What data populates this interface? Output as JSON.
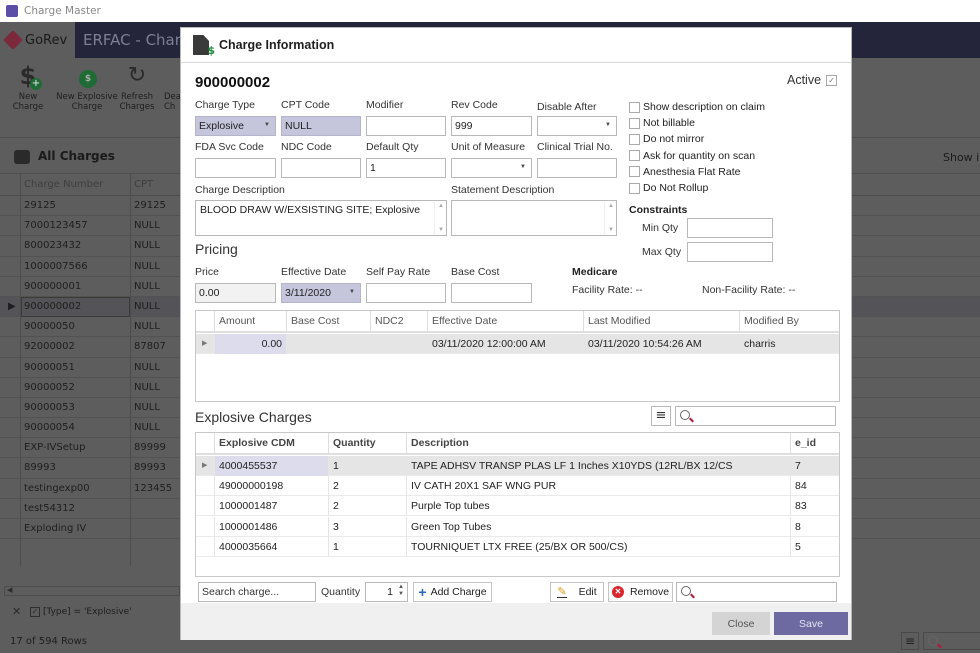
{
  "window": {
    "title": "Charge Master"
  },
  "app": {
    "brand": "GoRev",
    "title": "ERFAC - Char",
    "toolbar": [
      {
        "label_line1": "New Charge",
        "label_line2": "",
        "icon": "dollar-plus-icon"
      },
      {
        "label_line1": "New Explosive",
        "label_line2": "Charge",
        "icon": "bomb-icon"
      },
      {
        "label_line1": "Refresh",
        "label_line2": "Charges",
        "icon": "refresh-icon"
      },
      {
        "label_line1": "Dea",
        "label_line2": "Ch",
        "icon": "deactivate-icon"
      }
    ],
    "list": {
      "title": "All Charges",
      "show_text": "Show i",
      "columns": [
        "Charge Number",
        "CPT"
      ],
      "rows": [
        [
          "29125",
          "29125"
        ],
        [
          "7000123457",
          "NULL"
        ],
        [
          "800023432",
          "NULL"
        ],
        [
          "1000007566",
          "NULL"
        ],
        [
          "900000001",
          "NULL"
        ],
        [
          "900000002",
          "NULL"
        ],
        [
          "90000050",
          "NULL"
        ],
        [
          "92000002",
          "87807"
        ],
        [
          "90000051",
          "NULL"
        ],
        [
          "90000052",
          "NULL"
        ],
        [
          "90000053",
          "NULL"
        ],
        [
          "90000054",
          "NULL"
        ],
        [
          "EXP-IVSetup",
          "89999"
        ],
        [
          "89993",
          "89993"
        ],
        [
          "testingexp00",
          "123455"
        ],
        [
          "test54312",
          ""
        ],
        [
          "Exploding IV",
          ""
        ]
      ],
      "selected_index": 5,
      "filter": {
        "expression": "[Type] = 'Explosive'",
        "enabled": true
      },
      "row_count": "17 of 594 Rows"
    }
  },
  "dialog": {
    "title": "Charge Information",
    "charge_number": "900000002",
    "active": {
      "label": "Active",
      "checked": true
    },
    "fields": {
      "charge_type": {
        "label": "Charge Type",
        "value": "Explosive"
      },
      "cpt_code": {
        "label": "CPT Code",
        "value": "NULL"
      },
      "modifier": {
        "label": "Modifier",
        "value": ""
      },
      "rev_code": {
        "label": "Rev Code",
        "value": "999"
      },
      "disable_after": {
        "label": "Disable After",
        "value": ""
      },
      "fda_svc_code": {
        "label": "FDA Svc Code",
        "value": ""
      },
      "ndc_code": {
        "label": "NDC Code",
        "value": ""
      },
      "default_qty": {
        "label": "Default Qty",
        "value": "1"
      },
      "unit_of_measure": {
        "label": "Unit of Measure",
        "value": ""
      },
      "clinical_trial_no": {
        "label": "Clinical Trial No.",
        "value": ""
      },
      "charge_description": {
        "label": "Charge Description",
        "value": "BLOOD DRAW W/EXSISTING SITE; Explosive"
      },
      "statement_description": {
        "label": "Statement Description",
        "value": ""
      }
    },
    "options": [
      {
        "label": "Show description on claim",
        "checked": false
      },
      {
        "label": "Not billable",
        "checked": false
      },
      {
        "label": "Do not mirror",
        "checked": false
      },
      {
        "label": "Ask for quantity on scan",
        "checked": false
      },
      {
        "label": "Anesthesia Flat Rate",
        "checked": false
      },
      {
        "label": "Do Not Rollup",
        "checked": false
      }
    ],
    "constraints": {
      "title": "Constraints",
      "min_qty": {
        "label": "Min Qty",
        "value": ""
      },
      "max_qty": {
        "label": "Max Qty",
        "value": ""
      }
    },
    "pricing": {
      "title": "Pricing",
      "price": {
        "label": "Price",
        "value": "0.00"
      },
      "effective_date": {
        "label": "Effective Date",
        "value": "3/11/2020"
      },
      "self_pay_rate": {
        "label": "Self Pay Rate",
        "value": ""
      },
      "base_cost": {
        "label": "Base Cost",
        "value": ""
      }
    },
    "medicare": {
      "title": "Medicare",
      "facility_rate": "Facility Rate: --",
      "non_facility_rate": "Non-Facility Rate: --"
    },
    "price_table": {
      "columns": [
        "Amount",
        "Base Cost",
        "NDC2",
        "Effective Date",
        "Last Modified",
        "Modified By"
      ],
      "rows": [
        [
          "0.00",
          "",
          "",
          "03/11/2020 12:00:00 AM",
          "03/11/2020 10:54:26 AM",
          "charris"
        ]
      ]
    },
    "explosive": {
      "title": "Explosive Charges",
      "search_placeholder": "",
      "columns": [
        "Explosive CDM",
        "Quantity",
        "Description",
        "e_id"
      ],
      "rows": [
        [
          "4000455537",
          "1",
          "TAPE ADHSV TRANSP PLAS LF 1 Inches X10YDS (12RL/BX 12/CS",
          "7"
        ],
        [
          "49000000198",
          "2",
          "IV CATH 20X1 SAF WNG PUR",
          "84"
        ],
        [
          "1000001487",
          "2",
          "Purple Top tubes",
          "83"
        ],
        [
          "1000001486",
          "3",
          "Green Top Tubes",
          "8"
        ],
        [
          "4000035664",
          "1",
          "TOURNIQUET LTX FREE (25/BX OR 500/CS)",
          "5"
        ]
      ]
    },
    "add_bar": {
      "search_placeholder": "Search charge...",
      "quantity_label": "Quantity",
      "quantity_value": "1",
      "add_label": "Add Charge",
      "edit_label": "Edit",
      "remove_label": "Remove"
    },
    "footer": {
      "close_label": "Close",
      "save_label": "Save"
    }
  },
  "colors": {
    "accent": "#6c6aa0",
    "navbar": "#24253a",
    "disabled_field": "#c5c6dc",
    "remove": "#d9262c",
    "add": "#2a67c4"
  }
}
